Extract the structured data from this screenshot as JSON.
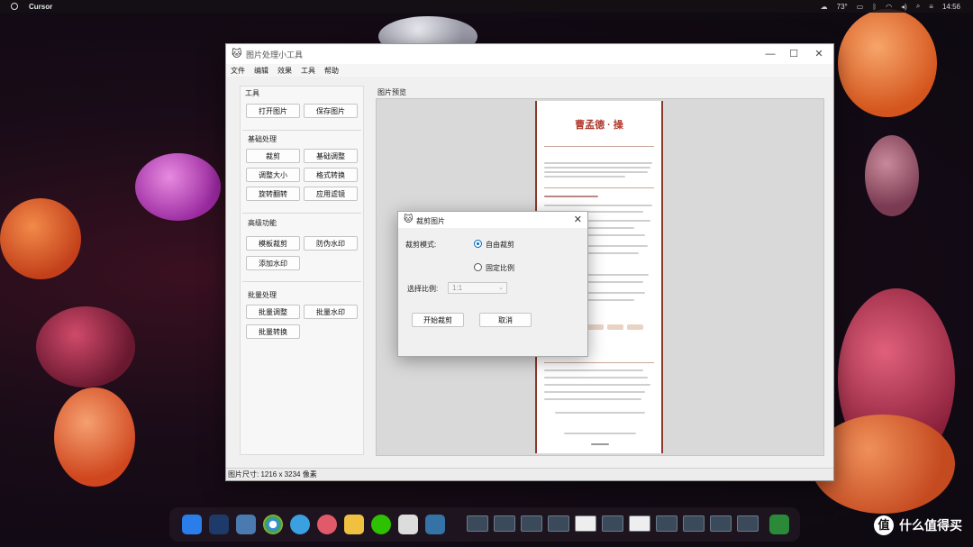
{
  "menubar": {
    "app_name": "Cursor",
    "weather": "73°",
    "time": "14:56"
  },
  "window": {
    "title": "图片处理小工具",
    "menu": [
      "文件",
      "编辑",
      "效果",
      "工具",
      "帮助"
    ],
    "controls": {
      "minimize": "—",
      "maximize": "☐",
      "close": "✕"
    }
  },
  "sidebar": {
    "tools_label": "工具",
    "open_label": "打开图片",
    "save_label": "保存图片",
    "basic_label": "基础处理",
    "crop_label": "裁剪",
    "basic_adjust_label": "基础调整",
    "resize_label": "调整大小",
    "format_label": "格式转换",
    "rotate_label": "旋转翻转",
    "filter_label": "应用滤镜",
    "advanced_label": "高级功能",
    "template_crop_label": "模板裁剪",
    "anti_watermark_label": "防伪水印",
    "add_watermark_label": "添加水印",
    "batch_label": "批量处理",
    "batch_adjust_label": "批量调整",
    "batch_watermark_label": "批量水印",
    "batch_convert_label": "批量转换"
  },
  "preview": {
    "label": "图片预览",
    "doc_title": "曹孟德 · 操"
  },
  "status": {
    "text": "图片尺寸: 1216 x 3234 像素"
  },
  "dialog": {
    "title": "裁剪图片",
    "mode_label": "裁剪模式:",
    "option_free": "自由裁剪",
    "option_fixed": "固定比例",
    "ratio_label": "选择比例:",
    "ratio_value": "1:1",
    "start_label": "开始裁剪",
    "cancel_label": "取消",
    "selected_mode": "自由裁剪"
  },
  "watermark": {
    "text": "什么值得买",
    "logo": "值"
  },
  "colors": {
    "accent": "#0067c0",
    "doc_title": "#b0392b"
  }
}
